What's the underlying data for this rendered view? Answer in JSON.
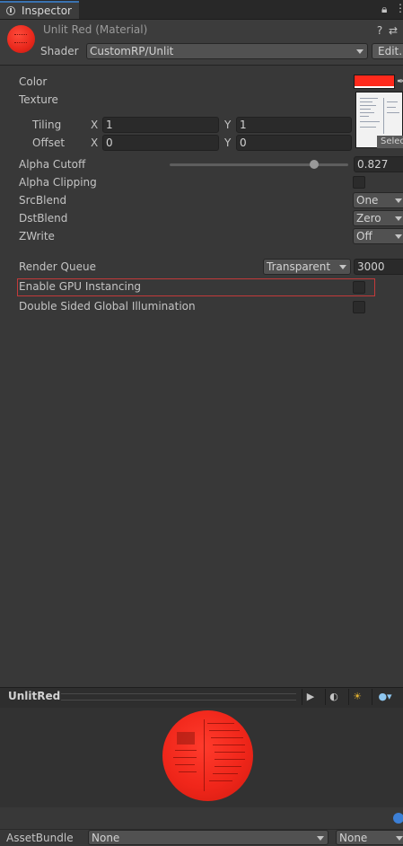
{
  "tab": {
    "title": "Inspector",
    "lock_icon": "lock-icon",
    "menu_icon": "kebab-menu-icon"
  },
  "header": {
    "material_title": "Unlit Red (Material)",
    "shader_label": "Shader",
    "shader_value": "CustomRP/Unlit",
    "edit_label": "Edit...",
    "help_icon": "help-icon",
    "settings_icon": "settings-sliders-icon"
  },
  "props": {
    "color_label": "Color",
    "color_value": "#ff2a1c",
    "texture_label": "Texture",
    "texture_select": "Select",
    "tiling_label": "Tiling",
    "offset_label": "Offset",
    "x_label": "X",
    "y_label": "Y",
    "tiling_x": "1",
    "tiling_y": "1",
    "offset_x": "0",
    "offset_y": "0",
    "alpha_cutoff_label": "Alpha Cutoff",
    "alpha_cutoff_value": "0.827",
    "alpha_clipping_label": "Alpha Clipping",
    "srcblend_label": "SrcBlend",
    "srcblend_value": "One",
    "dstblend_label": "DstBlend",
    "dstblend_value": "Zero",
    "zwrite_label": "ZWrite",
    "zwrite_value": "Off",
    "render_queue_label": "Render Queue",
    "render_queue_mode": "Transparent",
    "render_queue_value": "3000",
    "gpu_instancing_label": "Enable GPU Instancing",
    "double_sided_gi_label": "Double Sided Global Illumination"
  },
  "preview": {
    "title": "UnlitRed",
    "play_icon": "play-icon",
    "sphere_icon": "sphere-mesh-icon",
    "light_icon": "light-toggle-icon",
    "bg_icon": "background-sphere-icon"
  },
  "footer": {
    "assetbundle_label": "AssetBundle",
    "assetbundle_value": "None",
    "variant_value": "None"
  }
}
